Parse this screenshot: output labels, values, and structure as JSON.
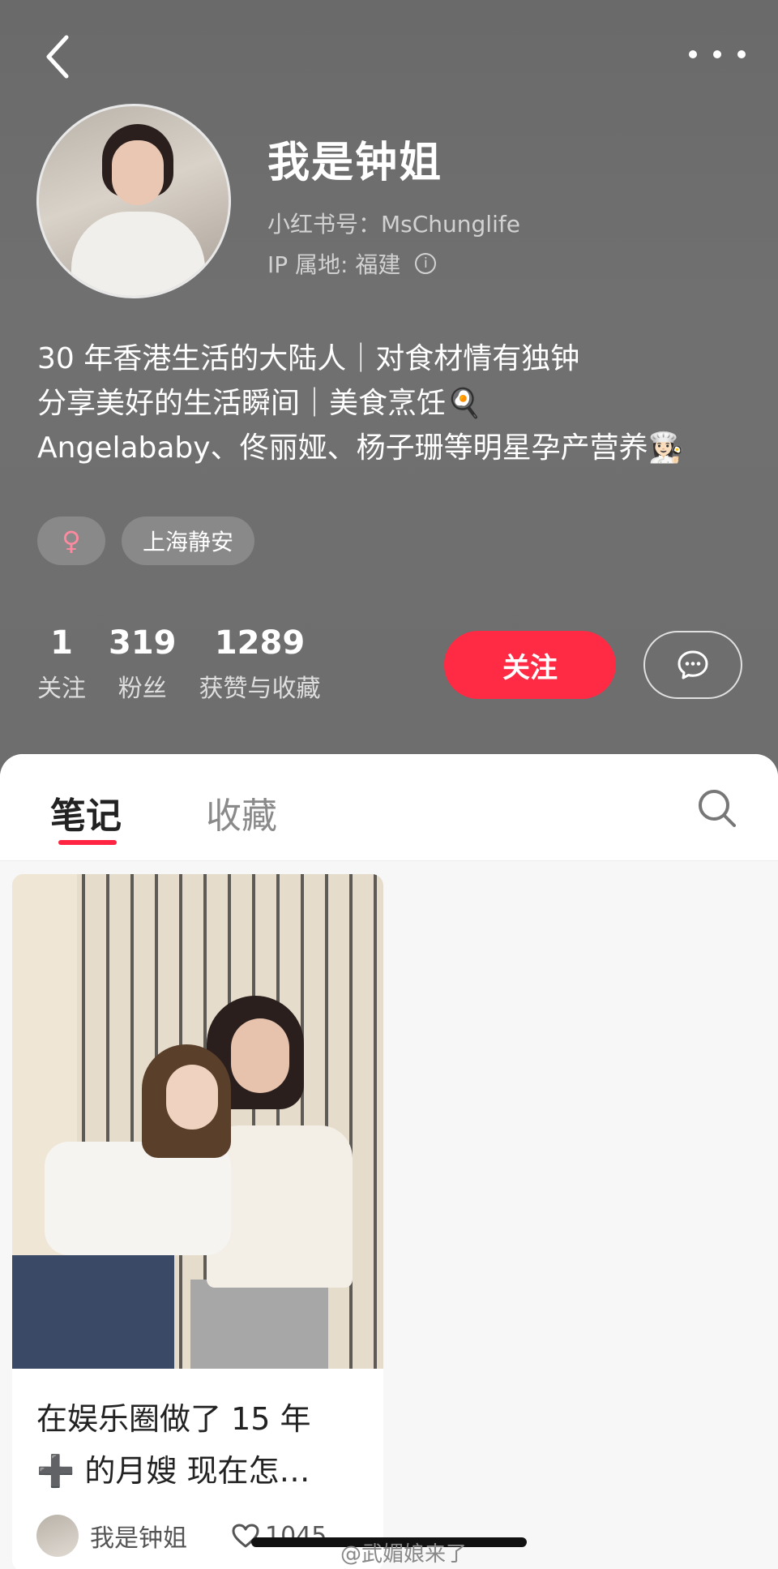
{
  "profile": {
    "name": "我是钟姐",
    "account_id": "小红书号：MsChunglife",
    "ip_location": "IP 属地: 福建",
    "bio": [
      "30 年香港生活的大陆人｜对食材情有独钟",
      "分享美好的生活瞬间｜美食烹饪🍳",
      "Angelababy、佟丽娅、杨子珊等明星孕产营养👩🏻‍🍳"
    ],
    "tags": {
      "gender": "♀",
      "location": "上海静安"
    },
    "stats": {
      "following_count": "1",
      "following_label": "关注",
      "followers_count": "319",
      "followers_label": "粉丝",
      "likes_count": "1289",
      "likes_label": "获赞与收藏"
    },
    "follow_label": "关注"
  },
  "tabs": {
    "notes": "笔记",
    "collections": "收藏"
  },
  "note": {
    "title_line1": "在娱乐圈做了 15 年",
    "title_line2": "➕ 的月嫂 现在怎…",
    "author": "我是钟姐",
    "likes": "1045"
  },
  "watermark": "@武媚娘来了",
  "colors": {
    "accent": "#ff2442",
    "header_bg": "#6e6e6e"
  }
}
